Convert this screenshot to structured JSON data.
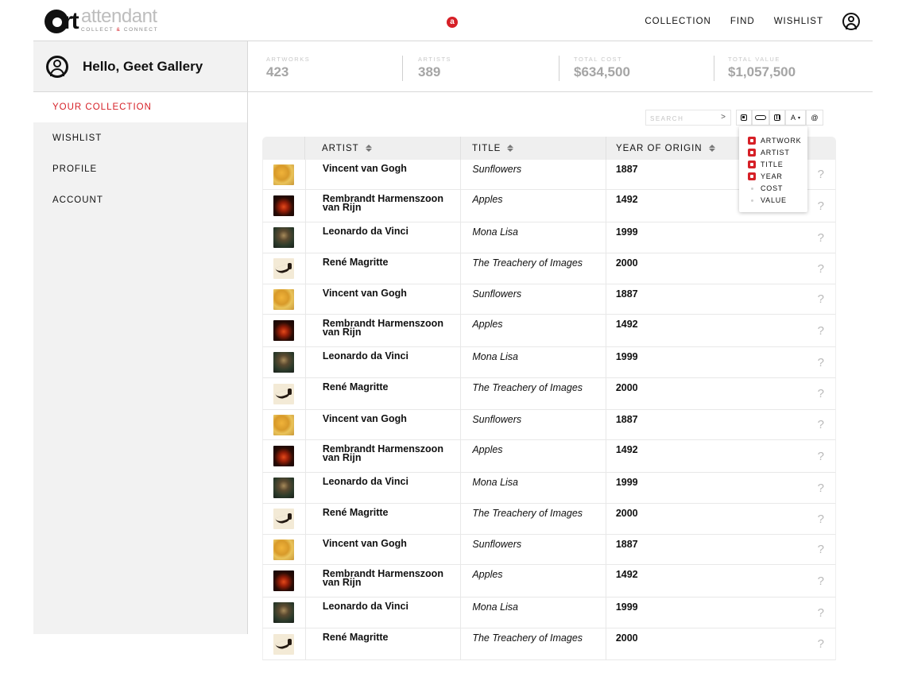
{
  "header": {
    "logo_word": "attendant",
    "logo_tag_left": "COLLECT",
    "logo_tag_amp": "&",
    "logo_tag_right": "CONNECT",
    "center_badge": "a",
    "nav": [
      "COLLECTION",
      "FIND",
      "WISHLIST"
    ],
    "user_icon": "user-icon"
  },
  "sidebar": {
    "greeting": "Hello, Geet Gallery",
    "items": [
      {
        "label": "YOUR COLLECTION",
        "active": true
      },
      {
        "label": "WISHLIST",
        "active": false
      },
      {
        "label": "PROFILE",
        "active": false
      },
      {
        "label": "ACCOUNT",
        "active": false
      }
    ]
  },
  "stats": [
    {
      "label": "ARTWORKS",
      "value": "423"
    },
    {
      "label": "ARTISTS",
      "value": "389"
    },
    {
      "label": "TOTAL COST",
      "value": "$634,500"
    },
    {
      "label": "TOTAL VALUE",
      "value": "$1,057,500"
    }
  ],
  "toolbar": {
    "search_placeholder": "SEARCH",
    "search_go": ">",
    "sort_label": "A",
    "at_label": "@"
  },
  "column_menu": [
    {
      "label": "ARTWORK",
      "checked": true
    },
    {
      "label": "ARTIST",
      "checked": true
    },
    {
      "label": "TITLE",
      "checked": true
    },
    {
      "label": "YEAR",
      "checked": true
    },
    {
      "label": "COST",
      "checked": false
    },
    {
      "label": "VALUE",
      "checked": false
    }
  ],
  "table": {
    "headers": [
      "ARTIST",
      "TITLE",
      "YEAR OF ORIGIN"
    ],
    "help_glyph": "?",
    "rows": [
      {
        "thumb": "sunflowers",
        "artist": "Vincent van Gogh",
        "title": "Sunflowers",
        "year": "1887"
      },
      {
        "thumb": "apples",
        "artist": "Rembrandt Harmenszoon van Rijn",
        "title": "Apples",
        "year": "1492"
      },
      {
        "thumb": "monalisa",
        "artist": "Leonardo da Vinci",
        "title": "Mona Lisa",
        "year": "1999"
      },
      {
        "thumb": "pipe",
        "artist": "René Magritte",
        "title": "The Treachery of Images",
        "year": "2000"
      },
      {
        "thumb": "sunflowers",
        "artist": "Vincent van Gogh",
        "title": "Sunflowers",
        "year": "1887"
      },
      {
        "thumb": "apples",
        "artist": "Rembrandt Harmenszoon van Rijn",
        "title": "Apples",
        "year": "1492"
      },
      {
        "thumb": "monalisa",
        "artist": "Leonardo da Vinci",
        "title": "Mona Lisa",
        "year": "1999"
      },
      {
        "thumb": "pipe",
        "artist": "René Magritte",
        "title": "The Treachery of Images",
        "year": "2000"
      },
      {
        "thumb": "sunflowers",
        "artist": "Vincent van Gogh",
        "title": "Sunflowers",
        "year": "1887"
      },
      {
        "thumb": "apples",
        "artist": "Rembrandt Harmenszoon van Rijn",
        "title": "Apples",
        "year": "1492"
      },
      {
        "thumb": "monalisa",
        "artist": "Leonardo da Vinci",
        "title": "Mona Lisa",
        "year": "1999"
      },
      {
        "thumb": "pipe",
        "artist": "René Magritte",
        "title": "The Treachery of Images",
        "year": "2000"
      },
      {
        "thumb": "sunflowers",
        "artist": "Vincent van Gogh",
        "title": "Sunflowers",
        "year": "1887"
      },
      {
        "thumb": "apples",
        "artist": "Rembrandt Harmenszoon van Rijn",
        "title": "Apples",
        "year": "1492"
      },
      {
        "thumb": "monalisa",
        "artist": "Leonardo da Vinci",
        "title": "Mona Lisa",
        "year": "1999"
      },
      {
        "thumb": "pipe",
        "artist": "René Magritte",
        "title": "The Treachery of Images",
        "year": "2000"
      }
    ]
  },
  "colors": {
    "accent": "#d62027",
    "sidebar_bg": "#f2f2f2",
    "stat_value": "#a5a5a5"
  }
}
